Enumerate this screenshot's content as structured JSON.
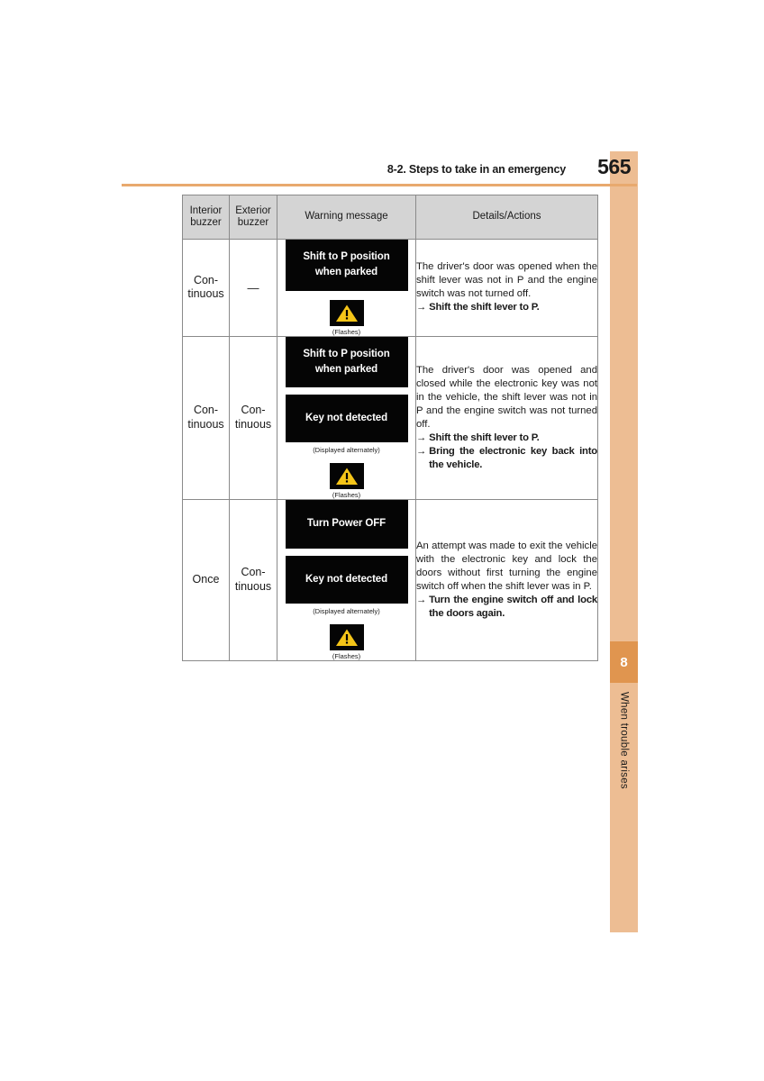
{
  "header": {
    "title": "8-2. Steps to take in an emergency",
    "page_number": "565"
  },
  "side_tab": {
    "chapter_number": "8",
    "chapter_label": "When trouble arises",
    "color_light": "#edbd93",
    "color_dark": "#e0954f"
  },
  "table": {
    "columns": [
      {
        "label": "Interior buzzer"
      },
      {
        "label": "Exterior buzzer"
      },
      {
        "label": "Warning message"
      },
      {
        "label": "Details/Actions"
      }
    ],
    "rows": [
      {
        "interior_buzzer": "Con-\ntinuous",
        "exterior_buzzer": "—",
        "messages": [
          {
            "line1": "Shift to P position",
            "line2": "when parked"
          }
        ],
        "alt_caption": "",
        "icon_name": "warning-triangle-icon",
        "icon_caption": "(Flashes)",
        "details": "The driver's door was opened when the shift lever was not in P and the engine switch was not turned off.",
        "actions": [
          {
            "arrow": "→",
            "text": "Shift the shift lever to P."
          }
        ]
      },
      {
        "interior_buzzer": "Con-\ntinuous",
        "exterior_buzzer": "Con-\ntinuous",
        "messages": [
          {
            "line1": "Shift to P position",
            "line2": "when parked"
          },
          {
            "line1": "Key not detected",
            "line2": ""
          }
        ],
        "alt_caption": "(Displayed alternately)",
        "icon_name": "warning-triangle-icon",
        "icon_caption": "(Flashes)",
        "details": "The driver's door was opened and closed while the electronic key was not in the vehicle, the shift lever was not in P and the engine switch was not turned off.",
        "actions": [
          {
            "arrow": "→",
            "text": "Shift the shift lever to P."
          },
          {
            "arrow": "→",
            "text": "Bring the electronic key back into the vehicle."
          }
        ]
      },
      {
        "interior_buzzer": "Once",
        "exterior_buzzer": "Con-\ntinuous",
        "messages": [
          {
            "line1": "Turn Power OFF",
            "line2": ""
          },
          {
            "line1": "Key not detected",
            "line2": ""
          }
        ],
        "alt_caption": "(Displayed alternately)",
        "icon_name": "warning-triangle-icon",
        "icon_caption": "(Flashes)",
        "details": "An attempt was made to exit the vehicle with the electronic key and lock the doors without first turning the engine switch off when the shift lever was in P.",
        "actions": [
          {
            "arrow": "→",
            "text": "Turn the engine switch off and lock the doors again."
          }
        ]
      }
    ]
  },
  "colors": {
    "header_rule": "#e8a96e",
    "table_header_bg": "#d4d4d4",
    "screen_bg": "#050505",
    "warning_yellow": "#f5c518"
  }
}
